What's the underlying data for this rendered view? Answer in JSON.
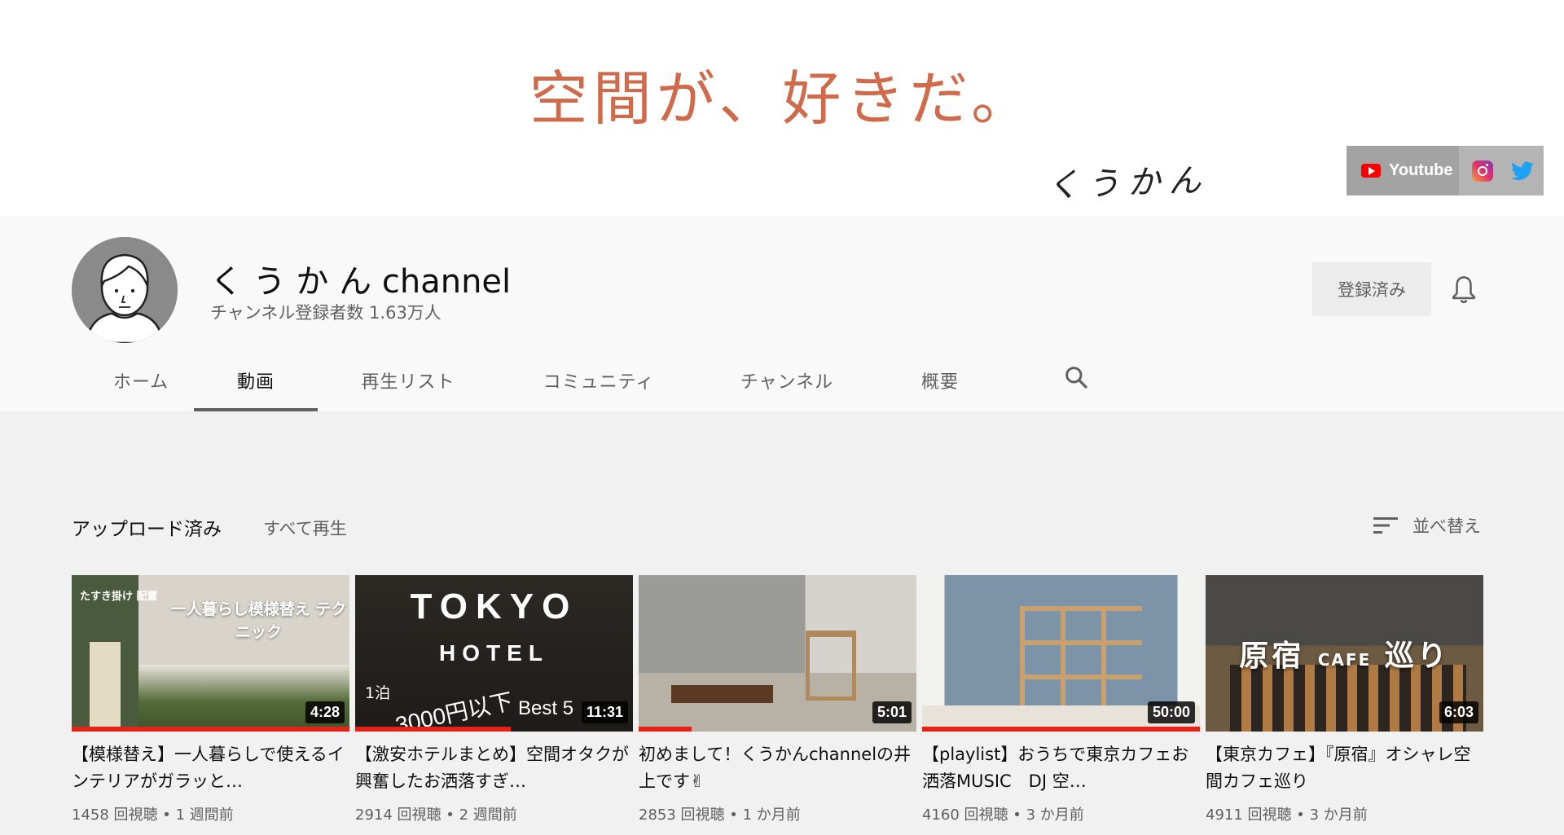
{
  "banner": {
    "title": "空間が、好きだ。",
    "signature": "くうかん",
    "social": {
      "youtube_label": "Youtube"
    }
  },
  "channel": {
    "name": "く う か ん channel",
    "subscribers": "チャンネル登録者数 1.63万人",
    "subscribed_label": "登録済み"
  },
  "tabs": [
    {
      "label": "ホーム"
    },
    {
      "label": "動画"
    },
    {
      "label": "再生リスト"
    },
    {
      "label": "コミュニティ"
    },
    {
      "label": "チャンネル"
    },
    {
      "label": "概要"
    }
  ],
  "active_tab": "動画",
  "uploads": {
    "title": "アップロード済み",
    "play_all": "すべて再生",
    "sort_label": "並べ替え"
  },
  "videos": [
    {
      "title": "【模様替え】一人暮らしで使えるインテリアがガラッと…",
      "views": "1458 回視聴",
      "age": "1 週間前",
      "duration": "4:28",
      "watched_fraction": 1.0,
      "thumb_text": {
        "badge": "たすき掛け 配置",
        "headline": "一人暮らし模様替え テクニック"
      }
    },
    {
      "title": "【激安ホテルまとめ】空間オタクが興奮したお洒落すぎ…",
      "views": "2914 回視聴",
      "age": "2 週間前",
      "duration": "11:31",
      "watched_fraction": 0.56,
      "thumb_text": {
        "big": "TOKYO",
        "mid": "HOTEL",
        "small": "1泊",
        "price": "3000円以下",
        "best": "Best 5"
      }
    },
    {
      "title": "初めまして！くうかんchannelの井上です✌",
      "views": "2853 回視聴",
      "age": "1 か月前",
      "duration": "5:01",
      "watched_fraction": 0.19
    },
    {
      "title": "【playlist】おうちで東京カフェお洒落MUSIC　DJ 空…",
      "views": "4160 回視聴",
      "age": "3 か月前",
      "duration": "50:00",
      "watched_fraction": 1.0
    },
    {
      "title": "【東京カフェ】『原宿』オシャレ空間カフェ巡り",
      "views": "4911 回視聴",
      "age": "3 か月前",
      "duration": "6:03",
      "watched_fraction": 0,
      "thumb_text": {
        "a": "原宿",
        "b": "CAFE",
        "c": "巡り"
      }
    }
  ],
  "colors": {
    "banner_title": "#cf6a4a",
    "progress": "#e62117",
    "twitter": "#1da1f2"
  }
}
